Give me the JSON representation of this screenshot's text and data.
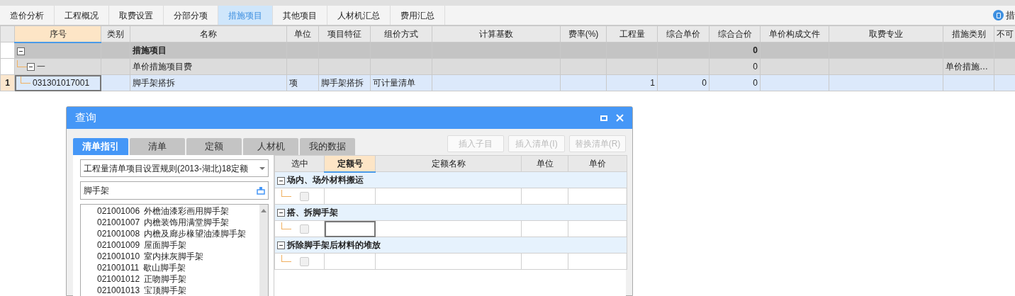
{
  "tabs": [
    {
      "label": "造价分析",
      "selected": false
    },
    {
      "label": "工程概况",
      "selected": false
    },
    {
      "label": "取费设置",
      "selected": false
    },
    {
      "label": "分部分项",
      "selected": false
    },
    {
      "label": "措施项目",
      "selected": true
    },
    {
      "label": "其他项目",
      "selected": false
    },
    {
      "label": "人材机汇总",
      "selected": false
    },
    {
      "label": "费用汇总",
      "selected": false
    }
  ],
  "side_action": {
    "label": "措"
  },
  "table": {
    "columns": [
      {
        "label": "序号",
        "selected": true
      },
      {
        "label": "类别",
        "selected": false
      },
      {
        "label": "名称",
        "selected": false
      },
      {
        "label": "单位",
        "selected": false
      },
      {
        "label": "项目特征",
        "selected": false
      },
      {
        "label": "组价方式",
        "selected": false
      },
      {
        "label": "计算基数",
        "selected": false
      },
      {
        "label": "费率(%)",
        "selected": false
      },
      {
        "label": "工程量",
        "selected": false
      },
      {
        "label": "综合单价",
        "selected": false
      },
      {
        "label": "综合合价",
        "selected": false
      },
      {
        "label": "单价构成文件",
        "selected": false
      },
      {
        "label": "取费专业",
        "selected": false
      },
      {
        "label": "措施类别",
        "selected": false
      },
      {
        "label": "不可",
        "selected": false
      }
    ],
    "rows": [
      {
        "kind": "group",
        "expanded": true,
        "selected": false,
        "name": "措施项目",
        "total": "0"
      },
      {
        "kind": "subgroup",
        "expanded": true,
        "selected": false,
        "code": "一",
        "name": "单价措施项目费",
        "total": "0",
        "category": "单价措施…"
      },
      {
        "kind": "item",
        "selected": true,
        "row_number": "1",
        "code": "031301017001",
        "name": "脚手架搭拆",
        "unit": "项",
        "feature": "脚手架搭拆",
        "pricing": "可计量清单",
        "quantity": "1",
        "unit_price": "0",
        "total": "0"
      }
    ]
  },
  "dialog": {
    "title": "查询",
    "tabs": [
      {
        "label": "清单指引",
        "selected": true
      },
      {
        "label": "清单",
        "selected": false
      },
      {
        "label": "定额",
        "selected": false
      },
      {
        "label": "人材机",
        "selected": false
      },
      {
        "label": "我的数据",
        "selected": false
      }
    ],
    "buttons": [
      {
        "label": "插入子目",
        "disabled": true
      },
      {
        "label": "插入清单(I)",
        "disabled": true
      },
      {
        "label": "替换清单(R)",
        "disabled": true
      }
    ],
    "library": "工程量清单项目设置规则(2013-湖北)18定额",
    "search": "脚手架",
    "list": [
      {
        "code": "021001006",
        "name": "外檐油漆彩画用脚手架"
      },
      {
        "code": "021001007",
        "name": "内檐装饰用满堂脚手架"
      },
      {
        "code": "021001008",
        "name": "内檐及廊步椽望油漆脚手架"
      },
      {
        "code": "021001009",
        "name": "屋面脚手架"
      },
      {
        "code": "021001010",
        "name": "室内抹灰脚手架"
      },
      {
        "code": "021001011",
        "name": "歇山脚手架"
      },
      {
        "code": "021001012",
        "name": "正吻脚手架"
      },
      {
        "code": "021001013",
        "name": "宝顶脚手架"
      }
    ],
    "columns": [
      {
        "label": "选中",
        "selected": false
      },
      {
        "label": "定额号",
        "selected": true
      },
      {
        "label": "定额名称",
        "selected": false
      },
      {
        "label": "单位",
        "selected": false
      },
      {
        "label": "单价",
        "selected": false
      }
    ],
    "groups": [
      {
        "name": "场内、场外材料搬运",
        "expanded": true,
        "rows": [
          {
            "checked": false,
            "selected": false
          }
        ]
      },
      {
        "name": "搭、拆脚手架",
        "expanded": true,
        "rows": [
          {
            "checked": false,
            "selected": true
          }
        ]
      },
      {
        "name": "拆除脚手架后材料的堆放",
        "expanded": true,
        "rows": [
          {
            "checked": false,
            "selected": false
          }
        ]
      }
    ]
  }
}
